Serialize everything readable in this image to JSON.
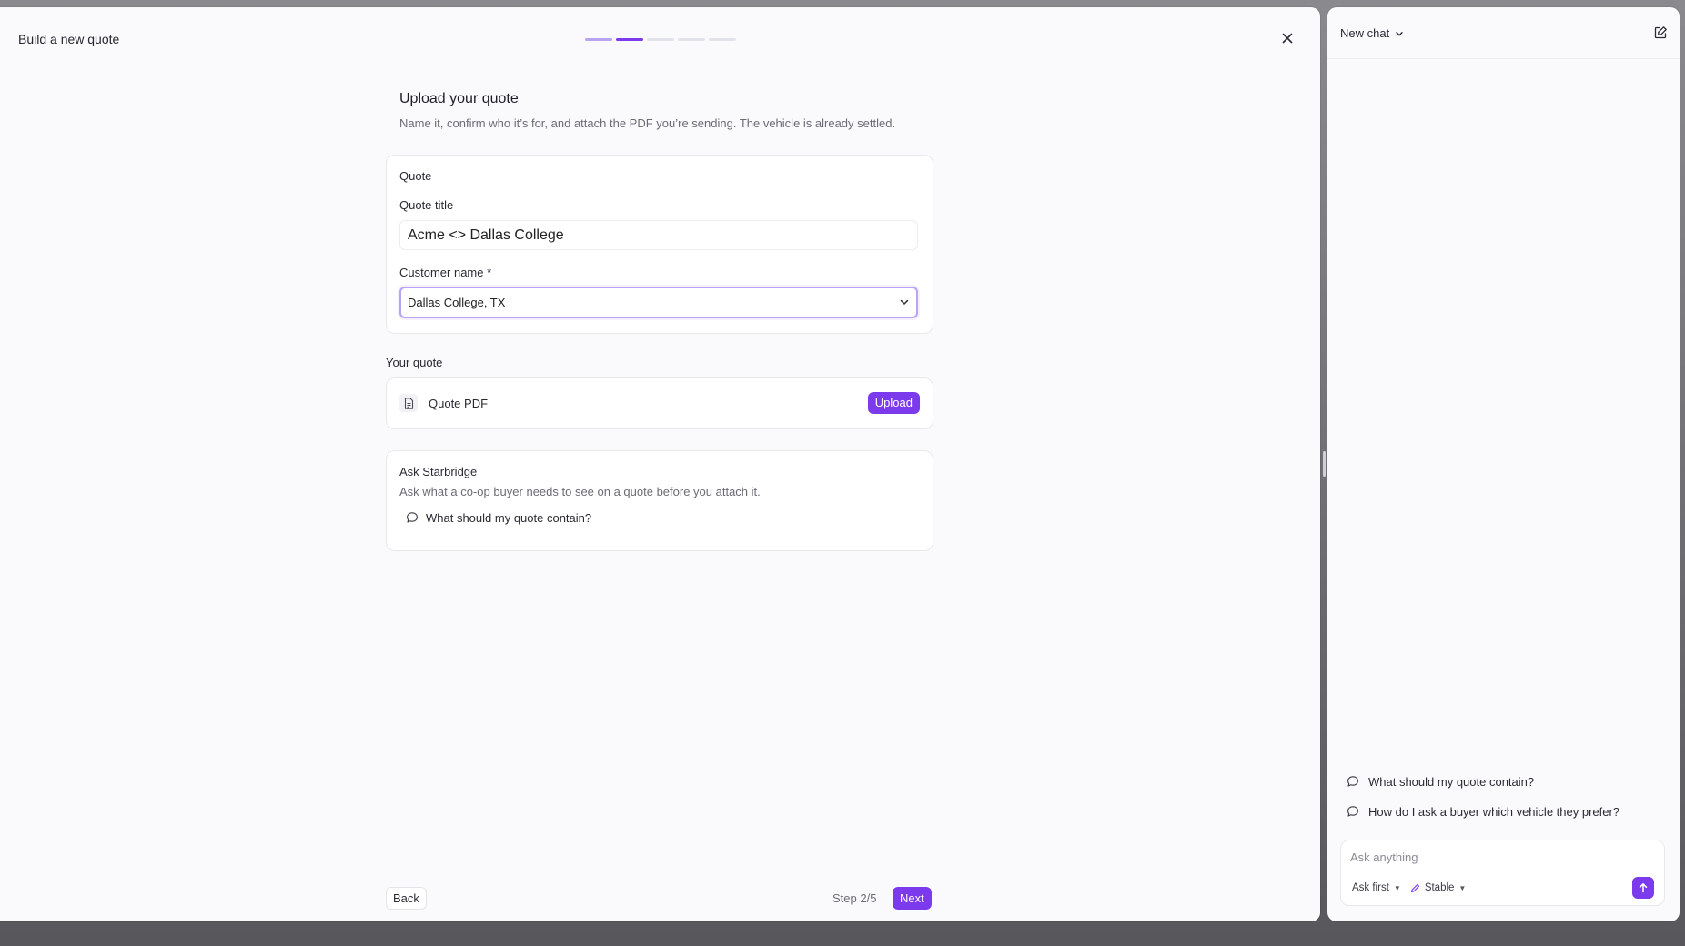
{
  "main": {
    "title": "Build a new quote",
    "progress": {
      "total_steps": 5,
      "current_step": 2
    },
    "heading": "Upload your quote",
    "subheading": "Name it, confirm who it’s for, and attach the PDF you’re sending. The vehicle is already settled.",
    "quote_card": {
      "label": "Quote",
      "title_label": "Quote title",
      "title_value": "Acme <> Dallas College",
      "customer_label": "Customer name *",
      "customer_value": "Dallas College, TX"
    },
    "your_quote": {
      "label": "Your quote",
      "file_name": "Quote PDF",
      "upload_label": "Upload"
    },
    "ask": {
      "label": "Ask Starbridge",
      "description": "Ask what a co-op buyer needs to see on a quote before you attach it.",
      "suggestion": "What should my quote contain?"
    },
    "footer": {
      "back_label": "Back",
      "step_text": "Step 2/5",
      "next_label": "Next"
    }
  },
  "chat": {
    "title": "New chat",
    "suggestions": [
      "What should my quote contain?",
      "How do I ask a buyer which vehicle they prefer?"
    ],
    "composer": {
      "placeholder": "Ask anything",
      "mode_label": "Ask first",
      "model_label": "Stable"
    }
  },
  "colors": {
    "accent": "#7c3aed",
    "accent_light": "#b7a3f0",
    "panel_bg": "#fafafd"
  }
}
